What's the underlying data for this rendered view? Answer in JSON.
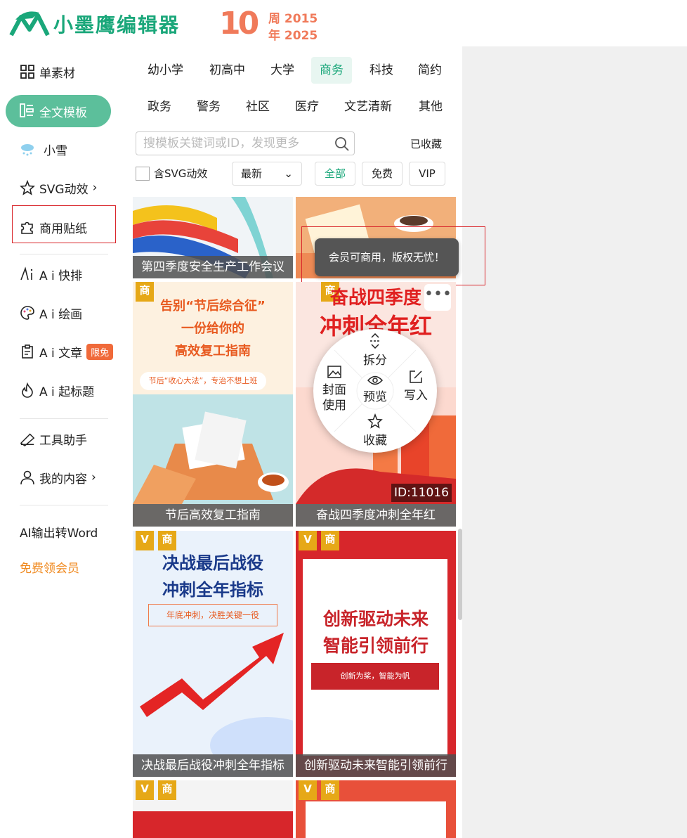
{
  "brand": {
    "name": "小墨鹰编辑器",
    "anniversary": "10",
    "anni_line1": "周 2015",
    "anni_line2": "年 2025"
  },
  "sidebar": {
    "items": [
      {
        "label": "单素材",
        "icon": "grid-icon"
      },
      {
        "label": "全文模板",
        "icon": "template-icon"
      },
      {
        "label": "小雪",
        "icon": "snow-cloud-icon"
      },
      {
        "label": "SVG动效",
        "icon": "star-svg-icon",
        "arrow": "›"
      },
      {
        "label": "商用贴纸",
        "icon": "puzzle-icon"
      },
      {
        "label": "A i 快排",
        "icon": "ai-icon"
      },
      {
        "label": "A i 绘画",
        "icon": "palette-icon"
      },
      {
        "label": "A i 文章",
        "icon": "clipboard-icon",
        "badge": "限免"
      },
      {
        "label": "A i 起标题",
        "icon": "flame-icon"
      },
      {
        "label": "工具助手",
        "icon": "ruler-icon"
      },
      {
        "label": "我的内容",
        "icon": "user-icon",
        "arrow": "›"
      }
    ],
    "ai_word": "AI输出转Word",
    "free_vip": "免费领会员"
  },
  "categories": {
    "row1": [
      "幼小学",
      "初高中",
      "大学",
      "商务",
      "科技",
      "简约"
    ],
    "row2": [
      "政务",
      "警务",
      "社区",
      "医疗",
      "文艺清新",
      "其他"
    ],
    "active": "商务"
  },
  "search": {
    "placeholder": "搜模板关键词或ID，发现更多",
    "favorites": "已收藏"
  },
  "filters": {
    "svg_checkbox": "含SVG动效",
    "sort": "最新",
    "sort_arrow": "⌄",
    "all": "全部",
    "free": "免费",
    "vip": "VIP"
  },
  "cards": [
    {
      "caption": "第四季度安全生产工作会议"
    },
    {
      "caption": ""
    },
    {
      "caption": "节后高效复工指南",
      "tag": "商",
      "headline1": "告别“节后综合征”",
      "headline2": "一份给你的",
      "headline3": "高效复工指南",
      "subline": "节后“收心大法”，专治不想上班"
    },
    {
      "caption": "奋战四季度冲刺全年红",
      "tag": "商",
      "headline1": "奋战四季度",
      "headline2": "冲刺全年红",
      "id": "ID:11016"
    },
    {
      "caption": "决战最后战役冲刺全年指标",
      "tag_v": "V",
      "tag": "商",
      "headline1": "决战最后战役",
      "headline2": "冲刺全年指标",
      "subline": "年底冲刺，决胜关键一役"
    },
    {
      "caption": "创新驱动未来智能引领前行",
      "tag_v": "V",
      "tag": "商",
      "headline1": "创新驱动未来",
      "headline2": "智能引领前行",
      "subline": "创新为桨，智能为帆"
    },
    {
      "tag_v": "V",
      "tag": "商"
    },
    {
      "tag_v": "V",
      "tag": "商"
    }
  ],
  "tooltip": "会员可商用，版权无忧！",
  "radial_menu": {
    "split": "拆分",
    "cover1": "封面",
    "cover2": "使用",
    "preview": "预览",
    "write": "写入",
    "collect": "收藏",
    "more": "•••"
  },
  "colors": {
    "brand": "#1aa77a",
    "active_nav": "#5cbf9b",
    "badge": "#f06a3a",
    "highlight": "#d9262b"
  }
}
